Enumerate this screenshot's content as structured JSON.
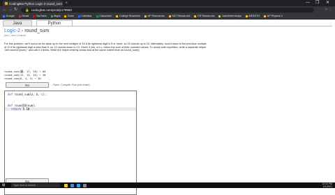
{
  "browser": {
    "tab_title": "CodingBat Python Logic-2 round_sum",
    "tab_close": "×",
    "new_tab": "+",
    "window_controls": [
      "—",
      "❐",
      "✕"
    ],
    "url": "codingbat.com/prob/p179960",
    "nav": {
      "back": "←",
      "forward": "→",
      "reload": "↻"
    },
    "toolbar_icons": "☆  ⋮"
  },
  "bookmarks": [
    {
      "label": "Google",
      "color": "#4285f4"
    },
    {
      "label": "Gmail",
      "color": "#d93025"
    },
    {
      "label": "YouTube",
      "color": "#ff0000"
    },
    {
      "label": "Maps",
      "color": "#34a853"
    },
    {
      "label": "Drive",
      "color": "#fbbc04"
    },
    {
      "label": "Calendar",
      "color": "#1a73e8"
    },
    {
      "label": "Classroom",
      "color": "#0f9d58"
    },
    {
      "label": "College Research",
      "color": "#f0c24b"
    },
    {
      "label": "AP Resources",
      "color": "#f0c24b"
    },
    {
      "label": "SAT Resources",
      "color": "#f0c24b"
    },
    {
      "label": "CS Resources",
      "color": "#f0c24b"
    },
    {
      "label": "Jobs/Internships",
      "color": "#f0c24b"
    },
    {
      "label": "ARGNTH",
      "color": "#f0c24b"
    },
    {
      "label": "AP Physics 1",
      "color": "#f0c24b"
    }
  ],
  "page": {
    "tabs": {
      "java": "Java",
      "python": "Python"
    },
    "title_prefix": "Logic-2",
    "title_sep": " › ",
    "title_name": "round_sum",
    "subnav": "prev  |  next  |  chance",
    "description": "For this problem, we'll round an int value up to the next multiple of 10 if its rightmost digit is 5 or more, so 15 rounds up to 20. Alternately, round down to the previous multiple of 10 if its rightmost digit is less than 5, so 12 rounds down to 10. Given 3 ints, a b c, return the sum of their rounded values. To avoid code repetition, write a separate helper \"def round10(num):\" and call it 3 times. Write the helper entirely below and at the same indent level as round_sum().",
    "examples": [
      {
        "pre": "round_sum(",
        "hl": "16",
        "post": ", 17, 18) → 60"
      },
      {
        "pre": "round_sum(12, 13, 14) → 30",
        "hl": "",
        "post": ""
      },
      {
        "pre": "round_sum(6, 4, 4) → 10",
        "hl": "",
        "post": ""
      }
    ],
    "go_label": "Go",
    "go_hint": "...Save, Compile, Run (ctrl-enter)",
    "code": [
      {
        "kw": "def ",
        "rest": "round_sum(a, b, c):"
      },
      {
        "kw": "",
        "rest": ""
      },
      {
        "kw": "",
        "rest": ""
      },
      {
        "kw": "def ",
        "rest": "round10(num):"
      },
      {
        "kw": "  return ",
        "rest": "5 10"
      }
    ],
    "go_label_bottom": "Go"
  },
  "taskbar": {
    "start": "⊞",
    "search_placeholder": "Type here to search",
    "time": "12:04 PM",
    "date": "2/1/2021",
    "apps": [
      {
        "name": "file-explorer",
        "color": "#f5c542"
      },
      {
        "name": "chrome",
        "color": "#4285f4"
      },
      {
        "name": "edge",
        "color": "#2fa4e7"
      },
      {
        "name": "store",
        "color": "#888888"
      }
    ]
  }
}
